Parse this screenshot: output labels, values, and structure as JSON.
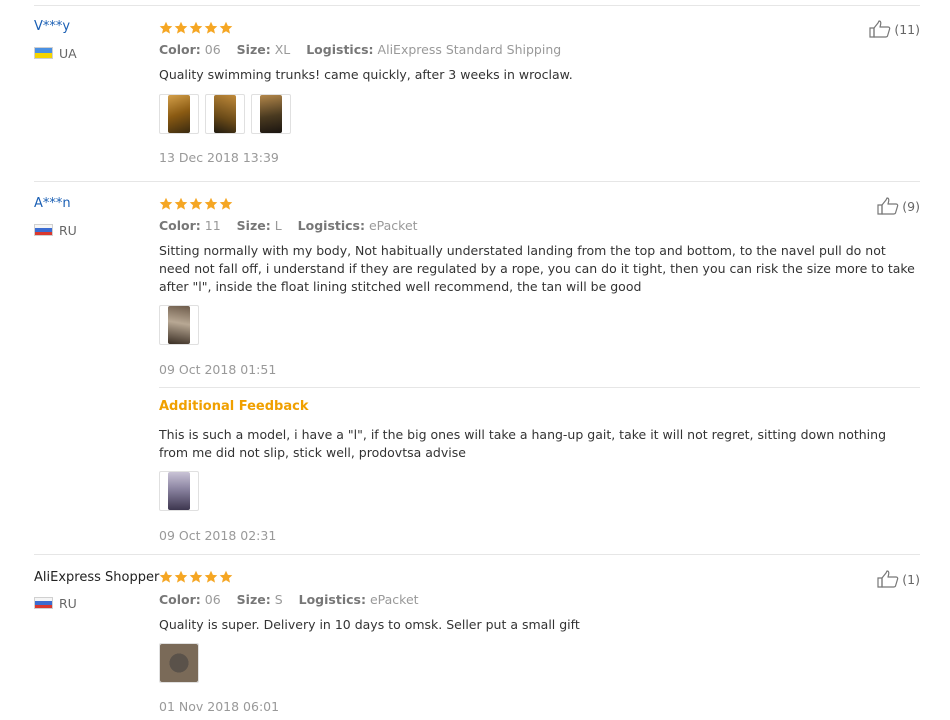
{
  "colors": {
    "username": "#1a5fb4",
    "stars": "#f5a623",
    "additional_feedback": "#f0a000",
    "meta_label": "#777777",
    "meta_value": "#999999"
  },
  "reviews": [
    {
      "user": "V***y",
      "country": "UA",
      "flag_icon": "ukraine-flag-icon",
      "rating": 5,
      "meta": {
        "color_label": "Color:",
        "color_value": "06",
        "size_label": "Size:",
        "size_value": "XL",
        "logistics_label": "Logistics:",
        "logistics_value": "AliExpress Standard Shipping"
      },
      "text": "Quality swimming trunks! came quickly, after 3 weeks in wroclaw.",
      "photos": [
        "review-photo",
        "review-photo",
        "review-photo"
      ],
      "date": "13 Dec 2018 13:39",
      "helpful_count": "(11)"
    },
    {
      "user": "A***n",
      "country": "RU",
      "flag_icon": "russia-flag-icon",
      "rating": 5,
      "meta": {
        "color_label": "Color:",
        "color_value": "11",
        "size_label": "Size:",
        "size_value": "L",
        "logistics_label": "Logistics:",
        "logistics_value": "ePacket"
      },
      "text": "Sitting normally with my body, Not habitually understated landing from the top and bottom, to the navel pull do not need not fall off, i understand if they are regulated by a rope, you can do it tight, then you can risk the size more to take after \"l\", inside the float lining stitched well recommend, the tan will be good",
      "photos": [
        "review-photo"
      ],
      "date": "09 Oct 2018 01:51",
      "additional": {
        "label": "Additional Feedback",
        "text": "This is such a model, i have a \"l\", if the big ones will take a hang-up gait, take it will not regret, sitting down nothing from me did not slip, stick well, prodovtsa advise",
        "photos": [
          "review-photo"
        ],
        "date": "09 Oct 2018 02:31"
      },
      "helpful_count": "(9)"
    },
    {
      "user": "AliExpress Shopper",
      "country": "RU",
      "flag_icon": "russia-flag-icon",
      "rating": 5,
      "meta": {
        "color_label": "Color:",
        "color_value": "06",
        "size_label": "Size:",
        "size_value": "S",
        "logistics_label": "Logistics:",
        "logistics_value": "ePacket"
      },
      "text": "Quality is super. Delivery in 10 days to omsk. Seller put a small gift",
      "photos": [
        "review-photo"
      ],
      "date": "01 Nov 2018 06:01",
      "helpful_count": "(1)"
    }
  ]
}
